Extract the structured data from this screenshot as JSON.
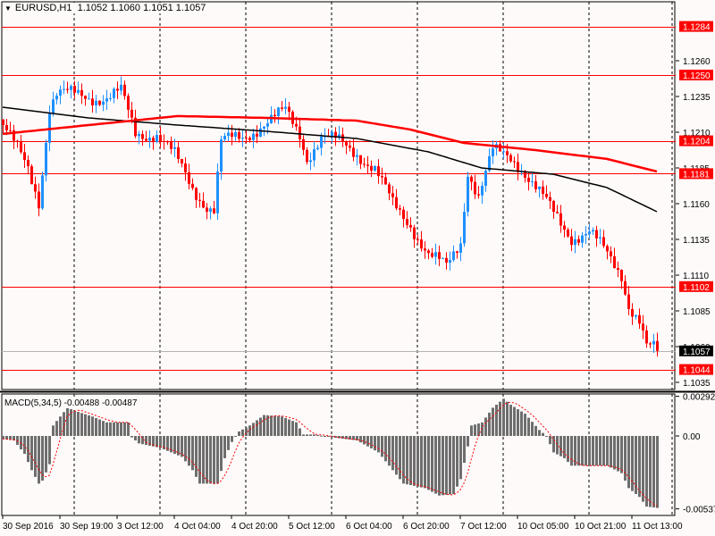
{
  "header": {
    "symbol": "EURUSD,H1",
    "open": "1.1052",
    "high": "1.1060",
    "low": "1.1051",
    "close": "1.1057"
  },
  "macd_header": "MACD(5,34,5) -0.00488 -0.00487",
  "colors": {
    "bull": "#1e90ff",
    "bear": "#ff0000",
    "ma_slow": "#ff0000",
    "ma_fast": "#000000",
    "level": "#ff0000",
    "hist": "#6e6e6e",
    "signal": "#ff0000",
    "bg": "#fffafa"
  },
  "chart_data": [
    {
      "type": "candlestick",
      "title": "EURUSD,H1",
      "bars": 184,
      "price_axis": {
        "ticks": [
          "1.1260",
          "1.1235",
          "1.1210",
          "1.1185",
          "1.1160",
          "1.1135",
          "1.1110",
          "1.1085",
          "1.1060",
          "1.1035"
        ],
        "ylim": [
          1.1026,
          1.1302
        ]
      },
      "time_labels": [
        "30 Sep 2016",
        "30 Sep 19:00",
        "3 Oct 12:00",
        "4 Oct 04:00",
        "4 Oct 20:00",
        "5 Oct 12:00",
        "6 Oct 04:00",
        "6 Oct 20:00",
        "7 Oct 12:00",
        "10 Oct 05:00",
        "10 Oct 21:00",
        "11 Oct 13:00"
      ],
      "close_path": [
        [
          0,
          1.1215
        ],
        [
          7,
          1.1184
        ],
        [
          10,
          1.1162
        ],
        [
          13,
          1.1228
        ],
        [
          15,
          1.1237
        ],
        [
          29,
          1.1234
        ],
        [
          33,
          1.1238
        ],
        [
          37,
          1.1209
        ],
        [
          43,
          1.1209
        ],
        [
          48,
          1.1193
        ],
        [
          53,
          1.1171
        ],
        [
          57,
          1.1159
        ],
        [
          59,
          1.1156
        ],
        [
          61,
          1.1203
        ],
        [
          67,
          1.1206
        ],
        [
          72,
          1.1215
        ],
        [
          79,
          1.1224
        ],
        [
          83,
          1.1209
        ],
        [
          85,
          1.1193
        ],
        [
          89,
          1.1206
        ],
        [
          94,
          1.1203
        ],
        [
          99,
          1.1196
        ],
        [
          104,
          1.1184
        ],
        [
          109,
          1.1159
        ],
        [
          114,
          1.1146
        ],
        [
          119,
          1.1124
        ],
        [
          124,
          1.1115
        ],
        [
          128,
          1.1134
        ],
        [
          130,
          1.1184
        ],
        [
          133,
          1.1165
        ],
        [
          137,
          1.1196
        ],
        [
          142,
          1.1193
        ],
        [
          145,
          1.1186
        ],
        [
          149,
          1.1171
        ],
        [
          154,
          1.1153
        ],
        [
          159,
          1.1137
        ],
        [
          164,
          1.114
        ],
        [
          169,
          1.1124
        ],
        [
          173,
          1.1111
        ],
        [
          175,
          1.109
        ],
        [
          178,
          1.1078
        ],
        [
          180,
          1.1059
        ],
        [
          183,
          1.1057
        ]
      ],
      "ma_slow": [
        [
          0,
          1.12088
        ],
        [
          24,
          1.1215
        ],
        [
          49,
          1.12213
        ],
        [
          74,
          1.122
        ],
        [
          99,
          1.12181
        ],
        [
          114,
          1.12119
        ],
        [
          129,
          1.12025
        ],
        [
          149,
          1.11975
        ],
        [
          169,
          1.11913
        ],
        [
          183,
          1.11825
        ]
      ],
      "ma_fast": [
        [
          0,
          1.12275
        ],
        [
          24,
          1.122
        ],
        [
          49,
          1.1215
        ],
        [
          74,
          1.12106
        ],
        [
          99,
          1.12056
        ],
        [
          119,
          1.11963
        ],
        [
          134,
          1.1185
        ],
        [
          154,
          1.11806
        ],
        [
          169,
          1.11713
        ],
        [
          183,
          1.11544
        ]
      ],
      "levels": [
        "1.1284",
        "1.1250",
        "1.1204",
        "1.1181",
        "1.1102",
        "1.1044"
      ],
      "bid": "1.1057"
    },
    {
      "type": "bar",
      "title": "MACD(5,34,5)",
      "axis_labels": [
        "0.00292",
        "0.00",
        "-0.00537"
      ],
      "ylim": [
        -0.00537,
        0.00292
      ],
      "histogram": [
        [
          0,
          -0.00022
        ],
        [
          3,
          -0.00033
        ],
        [
          6,
          -0.00132
        ],
        [
          8,
          -0.00252
        ],
        [
          10,
          -0.00351
        ],
        [
          11,
          -0.00329
        ],
        [
          13,
          -0.00208
        ],
        [
          14,
          0.00077
        ],
        [
          16,
          0.00143
        ],
        [
          18,
          0.00208
        ],
        [
          20,
          0.00186
        ],
        [
          25,
          0.00143
        ],
        [
          29,
          0.001
        ],
        [
          35,
          0.001
        ],
        [
          36,
          -0.00011
        ],
        [
          38,
          -0.00055
        ],
        [
          44,
          -0.00088
        ],
        [
          50,
          -0.00154
        ],
        [
          53,
          -0.00252
        ],
        [
          55,
          -0.00351
        ],
        [
          60,
          -0.00351
        ],
        [
          62,
          -0.00164
        ],
        [
          64,
          -0.00044
        ],
        [
          66,
          0.00033
        ],
        [
          69,
          0.00077
        ],
        [
          73,
          0.00154
        ],
        [
          78,
          0.00143
        ],
        [
          82,
          0.001
        ],
        [
          84,
          0.00011
        ],
        [
          87,
          0.00011
        ],
        [
          91,
          -7e-05
        ],
        [
          99,
          -0.00033
        ],
        [
          105,
          -0.00121
        ],
        [
          109,
          -0.00252
        ],
        [
          112,
          -0.00351
        ],
        [
          118,
          -0.00384
        ],
        [
          122,
          -0.00439
        ],
        [
          126,
          -0.00428
        ],
        [
          128,
          -0.00318
        ],
        [
          130,
          -0.00077
        ],
        [
          131,
          0.00077
        ],
        [
          134,
          0.00099
        ],
        [
          137,
          0.00208
        ],
        [
          140,
          0.00274
        ],
        [
          142,
          0.0023
        ],
        [
          146,
          0.00164
        ],
        [
          150,
          0.00044
        ],
        [
          152,
          0
        ],
        [
          154,
          -0.00121
        ],
        [
          157,
          -0.00164
        ],
        [
          159,
          -0.00219
        ],
        [
          169,
          -0.00219
        ],
        [
          173,
          -0.00274
        ],
        [
          175,
          -0.00384
        ],
        [
          178,
          -0.00449
        ],
        [
          180,
          -0.0052
        ],
        [
          183,
          -0.0053
        ]
      ]
    }
  ]
}
